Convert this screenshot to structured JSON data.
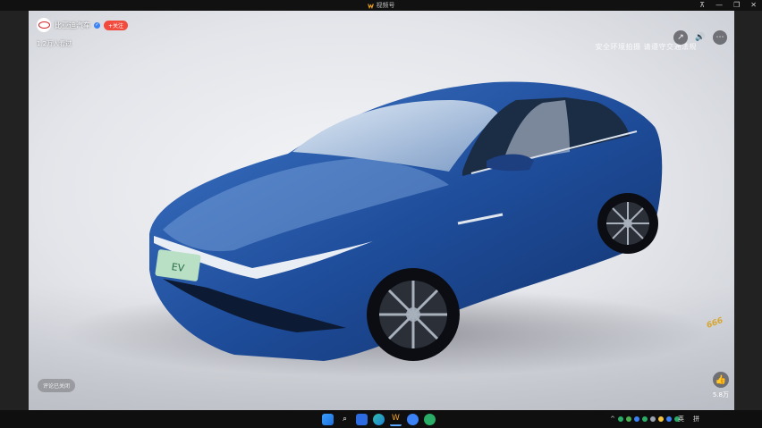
{
  "window": {
    "title": "视频号",
    "controls": [
      "⊼",
      "—",
      "❐",
      "✕"
    ]
  },
  "publisher": {
    "name": "比亚迪汽车",
    "follow_label": "+关注",
    "viewers": "1.2万人看过"
  },
  "notice": "安全环境拍摄 请遵守交通法规",
  "actions": {
    "share_icon": "share-icon",
    "volume_icon": "volume-icon",
    "more_icon": "more-icon"
  },
  "comments_status": "评论已关闭",
  "likes": {
    "count": "5.8万"
  },
  "watermark": "666",
  "taskbar": {
    "apps": [
      "start",
      "search",
      "widgets",
      "edge",
      "video-channel",
      "browser",
      "wechat"
    ],
    "input_lang": "英",
    "input_mode": "拼"
  },
  "colors": {
    "follow": "#f24a3d",
    "verify": "#3b82f6",
    "car_blue": "#1f4e9c"
  }
}
